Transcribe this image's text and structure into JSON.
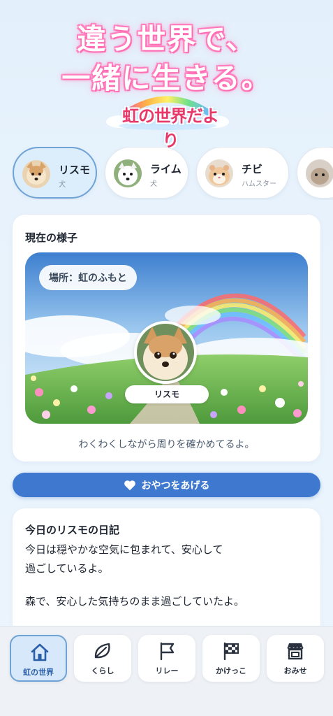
{
  "hero": {
    "line1": "違う世界で、",
    "line2": "一緒に生きる。",
    "logo_text": "虹の世界だより"
  },
  "pets": [
    {
      "name": "リスモ",
      "species": "犬",
      "active": true
    },
    {
      "name": "ライム",
      "species": "犬",
      "active": false
    },
    {
      "name": "チビ",
      "species": "ハムスター",
      "active": false
    }
  ],
  "status": {
    "title": "現在の様子",
    "location": "場所：虹のふもと",
    "pet_name": "リスモ",
    "message": "わくわくしながら周りを確かめてるよ。"
  },
  "treat_button": {
    "label": "おやつをあげる",
    "icon": "heart-icon"
  },
  "diary": {
    "title": "今日のリスモの日記",
    "paragraph1_line1": "今日は穏やかな空気に包まれて、安心して",
    "paragraph1_line2": "過ごしているよ。",
    "paragraph2": "森で、安心した気持ちのまま過ごしていたよ。"
  },
  "nav": [
    {
      "label": "虹の世界",
      "icon": "home-icon",
      "active": true
    },
    {
      "label": "くらし",
      "icon": "leaf-icon",
      "active": false
    },
    {
      "label": "リレー",
      "icon": "flag-icon",
      "active": false
    },
    {
      "label": "かけっこ",
      "icon": "checkered-flag-icon",
      "active": false
    },
    {
      "label": "おみせ",
      "icon": "shop-icon",
      "active": false
    }
  ],
  "colors": {
    "accent": "#3f78cf",
    "active_tab_bg": "#dcedfb",
    "active_border": "#6fa3d6",
    "hero_glow": "#ff6fb5"
  }
}
